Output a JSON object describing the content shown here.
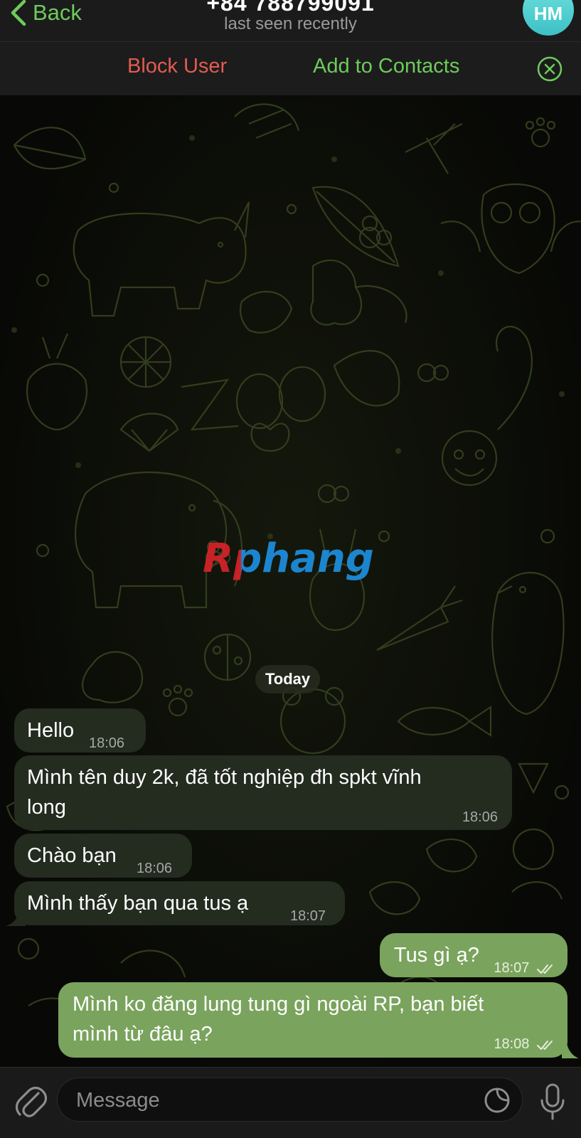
{
  "header": {
    "back_label": "Back",
    "title": "+84 788799091",
    "subtitle": "last seen recently",
    "avatar_initials": "HM"
  },
  "action_bar": {
    "block_label": "Block User",
    "add_label": "Add to Contacts"
  },
  "watermark": "Rphang",
  "date_label": "Today",
  "messages": [
    {
      "direction": "incoming",
      "text": "Hello",
      "time": "18:06"
    },
    {
      "direction": "incoming",
      "text": "Mình tên duy 2k, đã tốt nghiệp đh spkt vĩnh long",
      "line1": "Mình tên duy 2k, đã tốt nghiệp đh spkt vĩnh",
      "line2": "long",
      "time": "18:06"
    },
    {
      "direction": "incoming",
      "text": "Chào bạn",
      "time": "18:06"
    },
    {
      "direction": "incoming",
      "text": "Mình thấy bạn qua tus ạ",
      "time": "18:07"
    },
    {
      "direction": "outgoing",
      "text": "Tus gì ạ?",
      "time": "18:07",
      "status": "read"
    },
    {
      "direction": "outgoing",
      "text": "Mình ko đăng lung tung gì ngoài RP, bạn biết mình từ đâu ạ?",
      "line1": "Mình ko đăng lung tung gì ngoài RP, bạn biết",
      "line2": "mình từ đâu ạ?",
      "time": "18:08",
      "status": "read"
    }
  ],
  "composer": {
    "placeholder": "Message",
    "value": ""
  },
  "colors": {
    "accent_green": "#6ecb5c",
    "block_red": "#e35b52",
    "outgoing_bubble": "#7aa35d",
    "incoming_bubble": "#242b1f",
    "avatar": "#4fd1d2"
  },
  "icons": [
    "chevron-left-icon",
    "close-circle-icon",
    "paperclip-icon",
    "sticker-icon",
    "microphone-icon",
    "double-check-icon"
  ]
}
